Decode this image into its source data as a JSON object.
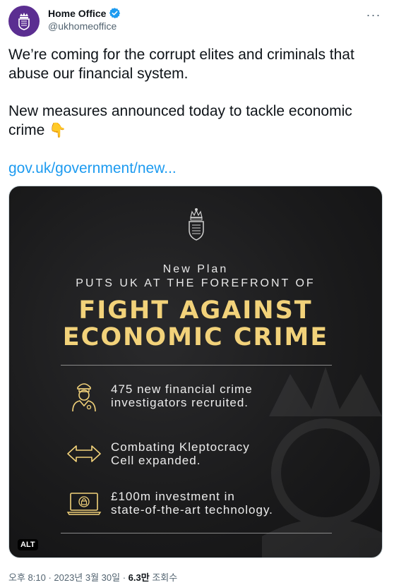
{
  "author": {
    "display_name": "Home Office",
    "handle": "@ukhomeoffice",
    "avatar_icon": "royal-crest-icon",
    "verified_icon": "verified-badge-icon",
    "avatar_color": "#5b2e91"
  },
  "tweet": {
    "line1": "We’re coming for the corrupt elites and criminals that abuse our financial system.",
    "line2": "New measures announced today to tackle economic crime",
    "emoji": "👇",
    "link": "gov.uk/government/new..."
  },
  "image": {
    "kicker": "New Plan",
    "subtitle": "PUTS UK AT THE FOREFRONT OF",
    "headline_1": "FIGHT AGAINST",
    "headline_2": "ECONOMIC CRIME",
    "items": [
      {
        "icon": "investigator-icon",
        "line1": "475 new financial crime",
        "line2": "investigators recruited."
      },
      {
        "icon": "arrows-left-right-icon",
        "line1": "Combating Kleptocracy",
        "line2": "Cell expanded."
      },
      {
        "icon": "laptop-lock-icon",
        "line1": "£100m investment in",
        "line2": "state-of-the-art technology."
      }
    ],
    "alt_label": "ALT",
    "headline_color": "#f2d27a"
  },
  "meta": {
    "timestamp": "오후 8:10 · 2023년 3월 30일 · ",
    "views_count": "6.3만",
    "views_label": " 조회수"
  },
  "accent_color": "#1d9bf0"
}
